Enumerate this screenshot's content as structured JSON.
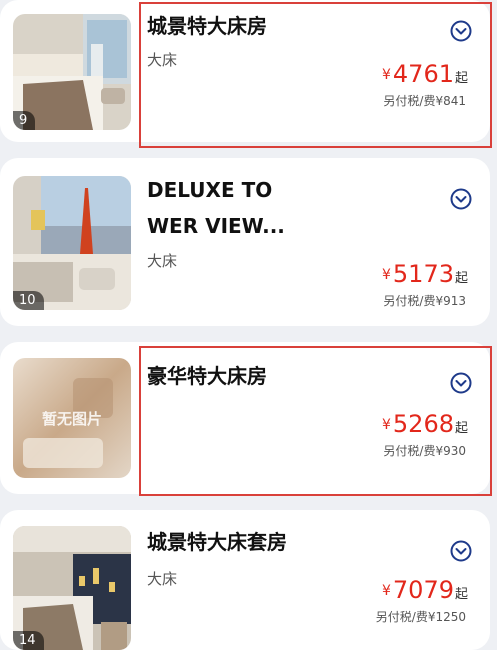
{
  "rooms": [
    {
      "name": "城景特大床房",
      "bed": "大床",
      "currency": "¥",
      "price": "4761",
      "price_suffix": "起",
      "tax_note": "另付税/费¥841",
      "photo_count": "9",
      "highlighted": true
    },
    {
      "name": "DELUXE TOWER VIEW...",
      "bed": "大床",
      "currency": "¥",
      "price": "5173",
      "price_suffix": "起",
      "tax_note": "另付税/费¥913",
      "photo_count": "10",
      "highlighted": false
    },
    {
      "name": "豪华特大床房",
      "bed": "",
      "currency": "¥",
      "price": "5268",
      "price_suffix": "起",
      "tax_note": "另付税/费¥930",
      "photo_count": "",
      "placeholder_text": "暂无图片",
      "highlighted": true
    },
    {
      "name": "城景特大床套房",
      "bed": "大床",
      "currency": "¥",
      "price": "7079",
      "price_suffix": "起",
      "tax_note": "另付税/费¥1250",
      "photo_count": "14",
      "highlighted": false
    }
  ],
  "colors": {
    "accent": "#1e3a8a",
    "price": "#e2271b",
    "highlight": "#d9403a",
    "background": "#eef0f4"
  },
  "icons": {
    "expand": "chevron-down-circle-icon"
  }
}
